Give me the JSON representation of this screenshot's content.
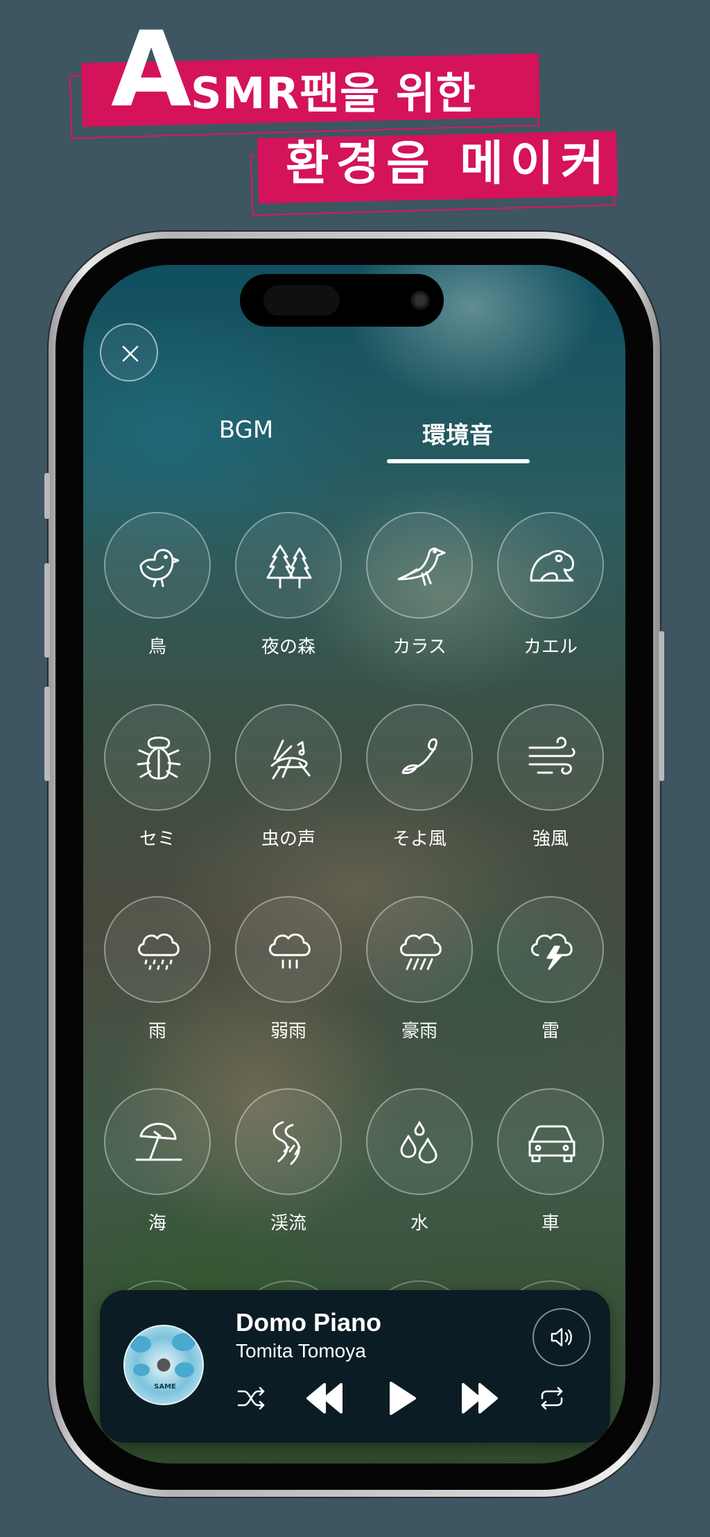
{
  "headline": {
    "big_letter": "A",
    "line1_rest": "SMR팬을 위한",
    "line2": "환경음 메이커",
    "banner_color": "#d4135a"
  },
  "tabs": [
    {
      "label": "BGM",
      "active": false
    },
    {
      "label": "環境音",
      "active": true
    }
  ],
  "sounds": [
    {
      "label": "鳥",
      "icon": "bird-icon"
    },
    {
      "label": "夜の森",
      "icon": "forest-icon"
    },
    {
      "label": "カラス",
      "icon": "crow-icon"
    },
    {
      "label": "カエル",
      "icon": "frog-icon"
    },
    {
      "label": "セミ",
      "icon": "cicada-icon"
    },
    {
      "label": "虫の声",
      "icon": "cricket-icon"
    },
    {
      "label": "そよ風",
      "icon": "breeze-icon"
    },
    {
      "label": "強風",
      "icon": "strong-wind-icon"
    },
    {
      "label": "雨",
      "icon": "rain-icon"
    },
    {
      "label": "弱雨",
      "icon": "light-rain-icon"
    },
    {
      "label": "豪雨",
      "icon": "heavy-rain-icon"
    },
    {
      "label": "雷",
      "icon": "thunder-icon"
    },
    {
      "label": "海",
      "icon": "beach-umbrella-icon"
    },
    {
      "label": "渓流",
      "icon": "stream-icon"
    },
    {
      "label": "水",
      "icon": "water-drops-icon"
    },
    {
      "label": "車",
      "icon": "car-icon"
    }
  ],
  "player": {
    "title": "Domo Piano",
    "artist": "Tomita Tomoya",
    "album_text": "SAME",
    "controls": [
      "shuffle-icon",
      "previous-icon",
      "play-icon",
      "next-icon",
      "repeat-icon",
      "volume-icon"
    ]
  }
}
